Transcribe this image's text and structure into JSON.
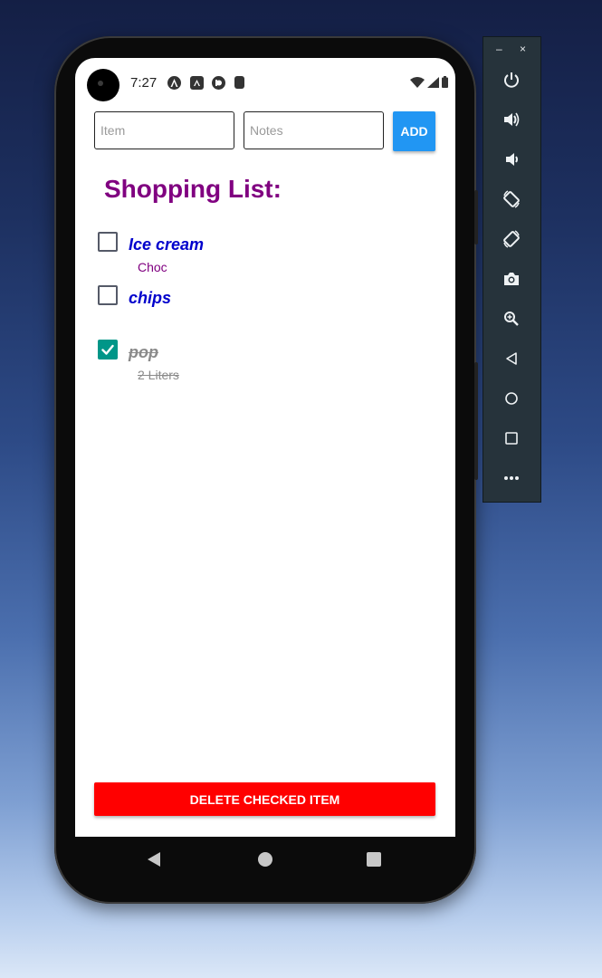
{
  "status_bar": {
    "time": "7:27",
    "icons": [
      "android-studio-icon",
      "a-square-icon",
      "expo-icon",
      "sd-card-icon",
      "wifi-icon",
      "signal-icon",
      "battery-icon"
    ]
  },
  "form": {
    "item_placeholder": "Item",
    "notes_placeholder": "Notes",
    "add_label": "ADD"
  },
  "list": {
    "title": "Shopping List:",
    "items": [
      {
        "name": "Ice cream",
        "note": "Choc",
        "checked": false
      },
      {
        "name": "chips",
        "note": "",
        "checked": false
      },
      {
        "name": "pop",
        "note": "2 Liters",
        "checked": true
      }
    ]
  },
  "actions": {
    "delete_label": "DELETE CHECKED ITEM"
  },
  "emulator_toolbar": {
    "minimize": "–",
    "close": "×",
    "buttons": [
      "power-icon",
      "volume-up-icon",
      "volume-down-icon",
      "rotate-left-icon",
      "rotate-right-icon",
      "camera-icon",
      "zoom-icon",
      "back-icon",
      "home-icon",
      "overview-icon",
      "more-icon"
    ]
  },
  "colors": {
    "title": "#800080",
    "item_name": "#0000cc",
    "note": "#800080",
    "checked_box": "#009688",
    "add_button": "#2196f3",
    "delete_button": "#ff0000",
    "toolbar": "#26333b"
  }
}
